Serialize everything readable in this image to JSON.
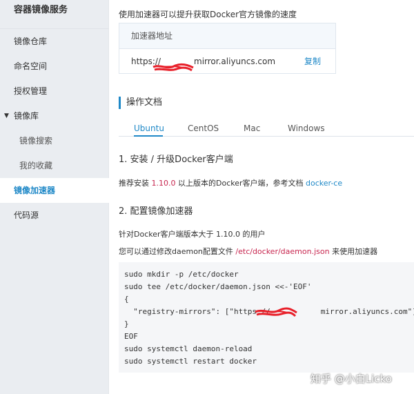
{
  "sidebar": {
    "title": "容器镜像服务",
    "items": [
      {
        "label": "镜像仓库"
      },
      {
        "label": "命名空间"
      },
      {
        "label": "授权管理"
      },
      {
        "label": "镜像库"
      },
      {
        "label": "镜像搜索"
      },
      {
        "label": "我的收藏"
      },
      {
        "label": "镜像加速器"
      },
      {
        "label": "代码源"
      }
    ],
    "group_caret": "▼"
  },
  "main": {
    "intro": "使用加速器可以提升获取Docker官方镜像的速度",
    "accelerator": {
      "header": "加速器地址",
      "url_prefix": "https://",
      "url_suffix": "mirror.aliyuncs.com",
      "copy_label": "复制"
    },
    "docs_title": "操作文档",
    "tabs": [
      {
        "label": "Ubuntu"
      },
      {
        "label": "CentOS"
      },
      {
        "label": "Mac"
      },
      {
        "label": "Windows"
      }
    ],
    "step1": {
      "title": "1. 安装 / 升级Docker客户端",
      "text_a": "推荐安装 ",
      "version": "1.10.0",
      "text_b": " 以上版本的Docker客户端，参考文档 ",
      "link": "docker-ce"
    },
    "step2": {
      "title": "2. 配置镜像加速器",
      "line1": "针对Docker客户端版本大于 1.10.0 的用户",
      "line2_a": "您可以通过修改daemon配置文件 ",
      "line2_path": "/etc/docker/daemon.json",
      "line2_b": " 来使用加速器"
    },
    "code": [
      "sudo mkdir -p /etc/docker",
      "sudo tee /etc/docker/daemon.json <<-'EOF'",
      "{",
      "  \"registry-mirrors\": [\"https://           mirror.aliyuncs.com\"]",
      "}",
      "EOF",
      "sudo systemctl daemon-reload",
      "sudo systemctl restart docker"
    ]
  },
  "watermark": "知乎 @小白Licko",
  "colors": {
    "accent": "#1e88c7",
    "sidebar_bg": "#eaedf1",
    "redaction": "#e8202a",
    "version": "#c7254e"
  }
}
